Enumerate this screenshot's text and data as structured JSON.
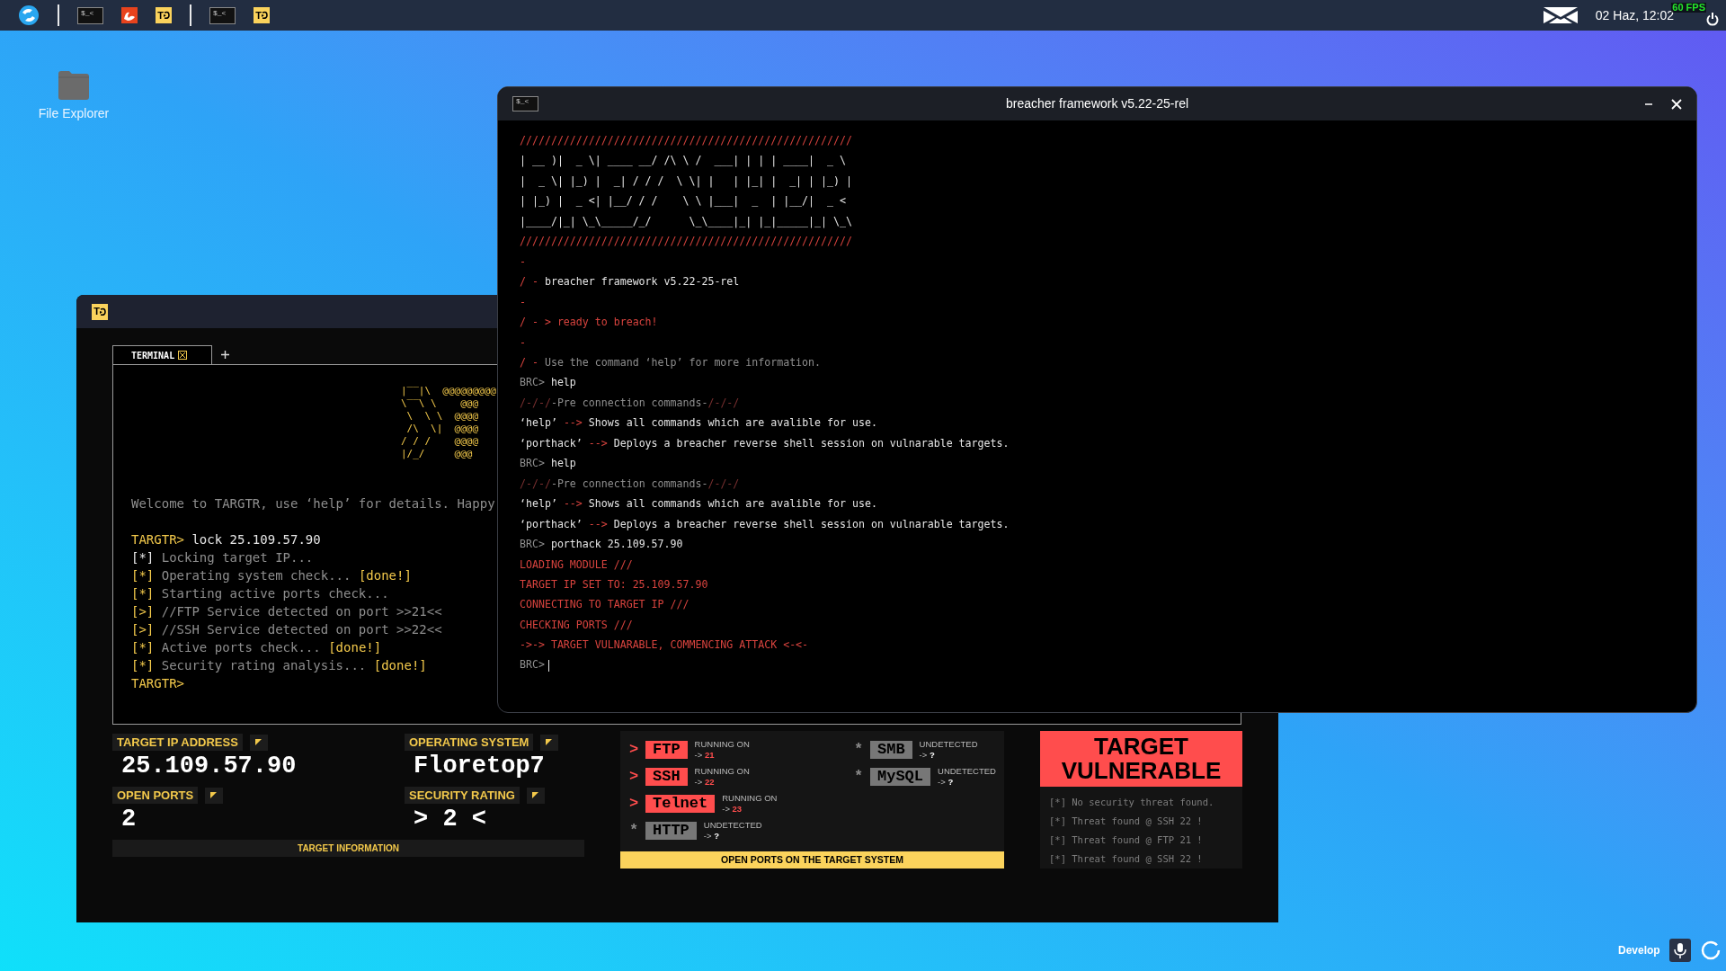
{
  "taskbar": {
    "groups": [
      [
        {
          "kind": "start"
        }
      ],
      [
        {
          "kind": "terminal",
          "label": "$_<"
        },
        {
          "kind": "flame"
        },
        {
          "kind": "targtr",
          "label": "T"
        }
      ],
      [
        {
          "kind": "terminal",
          "label": "$_<"
        },
        {
          "kind": "targtr",
          "label": "T"
        }
      ]
    ],
    "clock": "02 Haz, 12:02",
    "fps": "60 FPS"
  },
  "desktop_icons": [
    {
      "label": "File Explorer"
    }
  ],
  "targtr_window": {
    "icon_label": "T",
    "tab": {
      "label": "TERMINAL",
      "selected": true
    },
    "ascii_art": [
      "|‾‾|\\  @@@@@@@@@",
      "\\‾‾\\ \\    @@@",
      " \\  \\ \\  @@@@",
      " /\\  \\|  @@@@",
      "/ / /    @@@@",
      "|/_/     @@@"
    ],
    "welcome": "Welcome to TARGTR, use ‘help’ for details. Happy",
    "session": [
      [
        {
          "color": "#f3c94b",
          "text": "TARGTR> "
        },
        {
          "color": "#e6e6e6",
          "text": "lock 25.109.57.90"
        }
      ],
      [
        {
          "color": "#e6e6e6",
          "text": "[*]"
        },
        {
          "color": "#8e8e8e",
          "text": " Locking target IP..."
        }
      ],
      [
        {
          "color": "#f3c94b",
          "text": "[*]"
        },
        {
          "color": "#8e8e8e",
          "text": " Operating system check... "
        },
        {
          "color": "#f3c94b",
          "text": "[done!]"
        }
      ],
      [
        {
          "color": "#f3c94b",
          "text": "[*]"
        },
        {
          "color": "#8e8e8e",
          "text": " Starting active ports check..."
        }
      ],
      [
        {
          "color": "#f3c94b",
          "text": "[>]"
        },
        {
          "color": "#8e8e8e",
          "text": " //FTP Service detected on port >>21<<"
        }
      ],
      [
        {
          "color": "#f3c94b",
          "text": "[>]"
        },
        {
          "color": "#8e8e8e",
          "text": " //SSH Service detected on port >>22<<"
        }
      ],
      [
        {
          "color": "#f3c94b",
          "text": "[*]"
        },
        {
          "color": "#8e8e8e",
          "text": " Active ports check... "
        },
        {
          "color": "#f3c94b",
          "text": "[done!]"
        }
      ],
      [
        {
          "color": "#f3c94b",
          "text": "[*]"
        },
        {
          "color": "#8e8e8e",
          "text": " Security rating analysis... "
        },
        {
          "color": "#f3c94b",
          "text": "[done!]"
        }
      ],
      [
        {
          "color": "#f3c94b",
          "text": "TARGTR>"
        }
      ]
    ],
    "info": {
      "fields": [
        {
          "label": "TARGET IP ADDRESS",
          "value": "25.109.57.90"
        },
        {
          "label": "OPERATING SYSTEM",
          "value": "Floretop7"
        },
        {
          "label": "OPEN PORTS",
          "value": "2"
        },
        {
          "label": "SECURITY RATING",
          "value": "> 2 <"
        }
      ],
      "footer": "TARGET INFORMATION"
    },
    "ports": {
      "columns": [
        [
          {
            "marker": ">",
            "name": "FTP",
            "status": "RUNNING ON",
            "arrow": "->",
            "port": "21",
            "detected": true
          },
          {
            "marker": ">",
            "name": "SSH",
            "status": "RUNNING ON",
            "arrow": "->",
            "port": "22",
            "detected": true
          },
          {
            "marker": ">",
            "name": "Telnet",
            "status": "RUNNING ON",
            "arrow": "->",
            "port": "23",
            "detected": true
          },
          {
            "marker": "*",
            "name": "HTTP",
            "status": "UNDETECTED",
            "arrow": "->",
            "port": "?",
            "detected": false
          }
        ],
        [
          {
            "marker": "*",
            "name": "SMB",
            "status": "UNDETECTED",
            "arrow": "->",
            "port": "?",
            "detected": false
          },
          {
            "marker": "*",
            "name": "MySQL",
            "status": "UNDETECTED",
            "arrow": "->",
            "port": "?",
            "detected": false
          }
        ]
      ],
      "footer": "OPEN PORTS ON THE TARGET SYSTEM"
    },
    "verdict": {
      "headline": "TARGET VULNERABLE",
      "log": [
        "[*] No security threat found.",
        "[*] Threat found @ SSH 22 !",
        "[*] Threat found @ FTP 21 !",
        "[*] Threat found @ SSH 22 !"
      ]
    }
  },
  "breacher_window": {
    "icon_label": "$_<",
    "title": "breacher framework v5.22-25-rel",
    "lines": [
      [
        {
          "color": "#d8433e",
          "text": "/////////////////////////////////////////////////////"
        }
      ],
      [
        {
          "color": "#e6e6e6",
          "text": "| __ )|  _ \\| ____ __/ /\\ \\ /  ___| | | | ____|  _ \\"
        }
      ],
      [
        {
          "color": "#e6e6e6",
          "text": "|  _ \\| |_) |  _| / / /  \\ \\| |   | |_| |  _| | |_) |"
        }
      ],
      [
        {
          "color": "#e6e6e6",
          "text": "| |_) |  _ <| |__/ / /    \\ \\ |___|  _  | |__/|  _ <"
        }
      ],
      [
        {
          "color": "#e6e6e6",
          "text": "|____/|_| \\_\\_____/_/      \\_\\____|_| |_|_____|_| \\_\\"
        }
      ],
      [
        {
          "color": "#d8433e",
          "text": "/////////////////////////////////////////////////////"
        }
      ],
      [
        {
          "color": "#d8433e",
          "text": "-"
        }
      ],
      [
        {
          "color": "#d8433e",
          "text": "/ - "
        },
        {
          "color": "#e6e6e6",
          "text": "breacher framework v5.22-25-rel"
        }
      ],
      [
        {
          "color": "#d8433e",
          "text": "-"
        }
      ],
      [
        {
          "color": "#d8433e",
          "text": "/ - > ready to breach!"
        }
      ],
      [
        {
          "color": "#d8433e",
          "text": "-"
        }
      ],
      [
        {
          "color": "#d8433e",
          "text": "/ - "
        },
        {
          "color": "#8e8e8e",
          "text": "Use the command ‘help’ for more information."
        }
      ],
      [
        {
          "color": "#8e8e8e",
          "text": "BRC> "
        },
        {
          "color": "#e6e6e6",
          "text": "help"
        }
      ],
      [
        {
          "color": "#7a3030",
          "text": "/-/-/"
        },
        {
          "color": "#8e8e8e",
          "text": "-Pre connection commands-"
        },
        {
          "color": "#7a3030",
          "text": "/-/-/"
        }
      ],
      [
        {
          "color": "#e6e6e6",
          "text": "‘help’ "
        },
        {
          "color": "#d8433e",
          "text": "-->"
        },
        {
          "color": "#e6e6e6",
          "text": " Shows all commands which are avalible for use."
        }
      ],
      [
        {
          "color": "#e6e6e6",
          "text": "‘porthack’ "
        },
        {
          "color": "#d8433e",
          "text": "-->"
        },
        {
          "color": "#e6e6e6",
          "text": " Deploys a breacher reverse shell session on vulnarable targets."
        }
      ],
      [
        {
          "color": "#8e8e8e",
          "text": "BRC> "
        },
        {
          "color": "#e6e6e6",
          "text": "help"
        }
      ],
      [
        {
          "color": "#7a3030",
          "text": "/-/-/"
        },
        {
          "color": "#8e8e8e",
          "text": "-Pre connection commands-"
        },
        {
          "color": "#7a3030",
          "text": "/-/-/"
        }
      ],
      [
        {
          "color": "#e6e6e6",
          "text": "‘help’ "
        },
        {
          "color": "#d8433e",
          "text": "-->"
        },
        {
          "color": "#e6e6e6",
          "text": " Shows all commands which are avalible for use."
        }
      ],
      [
        {
          "color": "#e6e6e6",
          "text": "‘porthack’ "
        },
        {
          "color": "#d8433e",
          "text": "-->"
        },
        {
          "color": "#e6e6e6",
          "text": " Deploys a breacher reverse shell session on vulnarable targets."
        }
      ],
      [
        {
          "color": "#8e8e8e",
          "text": "BRC> "
        },
        {
          "color": "#e6e6e6",
          "text": "porthack 25.109.57.90"
        }
      ],
      [
        {
          "color": "#d8433e",
          "text": "LOADING MODULE ///"
        }
      ],
      [
        {
          "color": "#d8433e",
          "text": "TARGET IP SET TO: 25.109.57.90"
        }
      ],
      [
        {
          "color": "#d8433e",
          "text": "CONNECTING TO TARGET IP ///"
        }
      ],
      [
        {
          "color": "#d8433e",
          "text": "CHECKING PORTS ///"
        }
      ],
      [
        {
          "color": "#d8433e",
          "text": "->-> TARGET VULNARABLE, COMMENCING ATTACK <-<-"
        }
      ]
    ],
    "prompt": {
      "text": "BRC>",
      "cursor": true
    }
  },
  "corner": {
    "label": "Develop"
  }
}
